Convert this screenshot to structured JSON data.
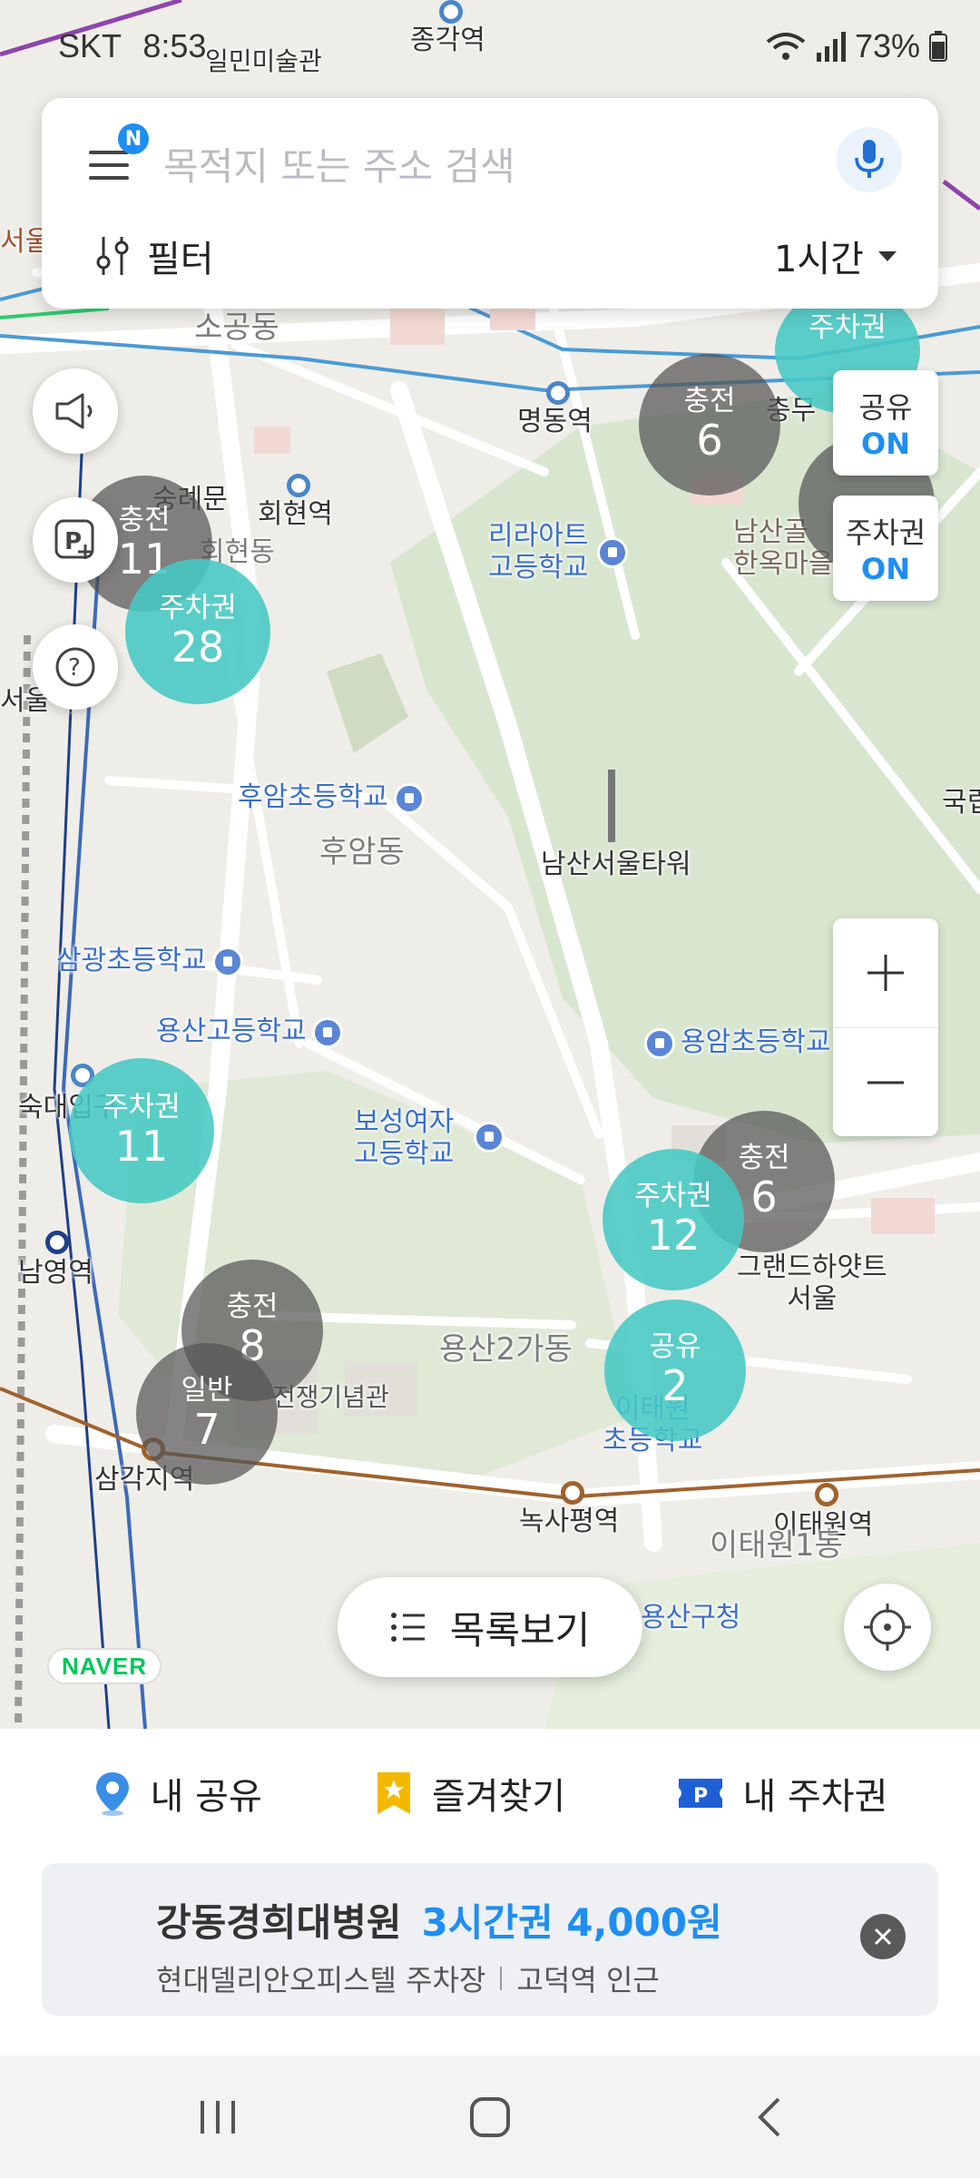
{
  "status_bar": {
    "carrier": "SKT",
    "time": "8:53",
    "battery": "73%"
  },
  "search": {
    "placeholder": "목적지 또는 주소 검색",
    "menu_badge": "N",
    "filter_label": "필터",
    "time_option": "1시간"
  },
  "toggles": {
    "share_label": "공유",
    "share_state": "ON",
    "ticket_label": "주차권",
    "ticket_state": "ON"
  },
  "map": {
    "places": {
      "jonggak": "종각역",
      "myeongdong": "명동역",
      "hoehyeon": "회현역",
      "sungnyemun": "숭례문",
      "sogong": "소공동",
      "chungmu": "충무",
      "lilart": "리라아트\n고등학교",
      "namsan_hanok": "남산골\n한옥마을",
      "huam_elem": "후암초등학교",
      "huam_dong": "후암동",
      "namsan_tower": "남산서울타워",
      "samgwang": "삼광초등학교",
      "yongsan_high": "용산고등학교",
      "yongam": "용암초등학교",
      "boseong": "보성여자\n고등학교",
      "sookmyung": "숙대입구",
      "namyeong": "남영역",
      "grand_hyatt": "그랜드하얏트\n서울",
      "yongsan2ga": "용산2가동",
      "war_memorial": "전쟁기념관",
      "samgakji": "삼각지역",
      "noksapyeong": "녹사평역",
      "itaewon": "이태원역",
      "itaewon1": "이태원1동",
      "yongsan_gu": "용산구청",
      "itaewon_elem": "이태원\n초등학교",
      "seoul_station": "서울역",
      "hoehyeon_dong": "회현동",
      "ilmin": "일민미술관",
      "seoul_left": "서울",
      "national": "국립"
    },
    "clusters": [
      {
        "id": "share-1",
        "label": "공유",
        "count": "2",
        "kind": "teal"
      },
      {
        "id": "ticket-a",
        "label": "주차권",
        "count": "28",
        "kind": "teal"
      },
      {
        "id": "charge-a",
        "label": "충전",
        "count": "11",
        "kind": "gray"
      },
      {
        "id": "charge-b",
        "label": "충전",
        "count": "6",
        "kind": "gray"
      },
      {
        "id": "ticket-b",
        "label": "주차권",
        "count": "",
        "kind": "teal"
      },
      {
        "id": "ticket-c",
        "label": "주차권",
        "count": "11",
        "kind": "teal"
      },
      {
        "id": "charge-c",
        "label": "충전",
        "count": "8",
        "kind": "gray"
      },
      {
        "id": "general-a",
        "label": "일반",
        "count": "7",
        "kind": "gray"
      },
      {
        "id": "charge-d",
        "label": "충전",
        "count": "6",
        "kind": "gray"
      },
      {
        "id": "ticket-d",
        "label": "주차권",
        "count": "12",
        "kind": "teal"
      },
      {
        "id": "share-2",
        "label": "공유",
        "count": "2",
        "kind": "teal"
      }
    ],
    "list_button": "목록보기",
    "naver_logo": "NAVER"
  },
  "bottom": {
    "my_share": "내 공유",
    "favorites": "즐겨찾기",
    "my_ticket": "내 주차권",
    "recent": {
      "place": "강동경희대병원",
      "ticket": "3시간권 4,000원",
      "lot": "현대델리안오피스텔 주차장",
      "near": "고덕역 인근"
    }
  },
  "colors": {
    "accent": "#1f8ef1",
    "teal_cluster": "#46c8c4",
    "gray_cluster": "#555555",
    "map_bg": "#efede8",
    "park": "#d8e6cf"
  }
}
